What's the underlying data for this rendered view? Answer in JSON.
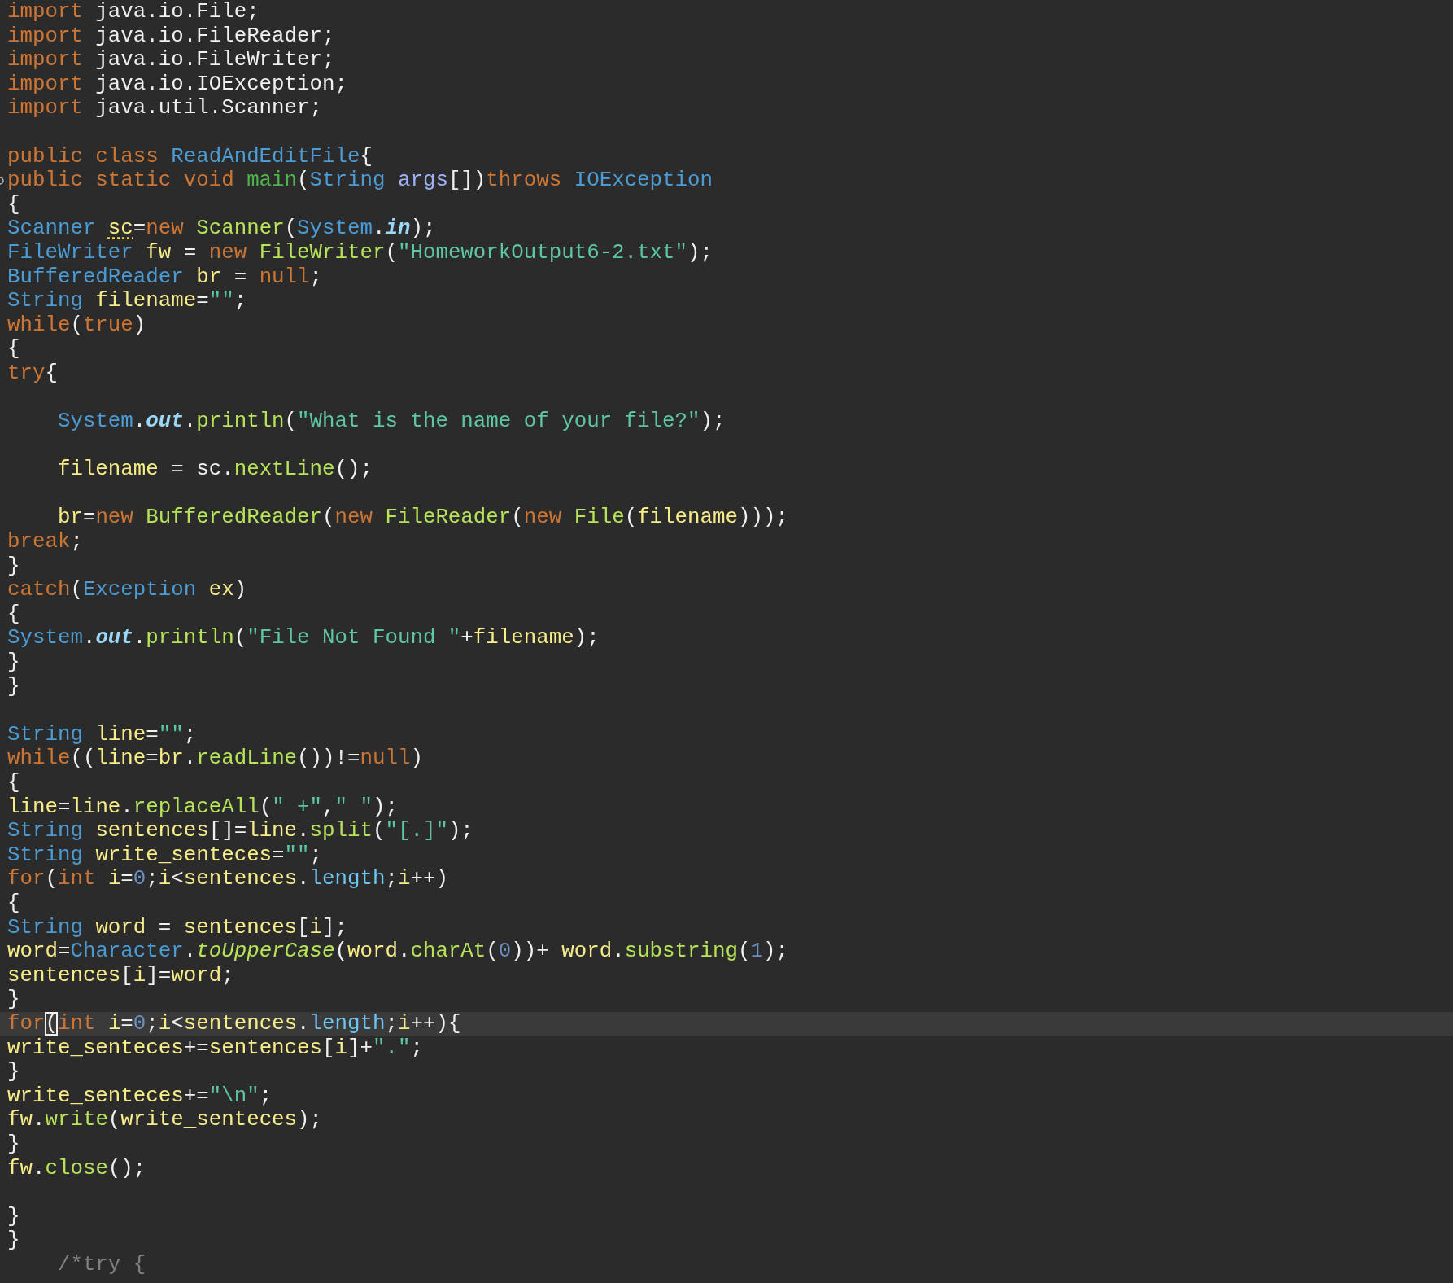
{
  "editor": {
    "lines": [
      {
        "current": false,
        "marker": false,
        "tokens": [
          {
            "kind": "keyword",
            "text": "import"
          },
          {
            "kind": "plain",
            "text": " java.io.File;"
          }
        ]
      },
      {
        "current": false,
        "marker": false,
        "tokens": [
          {
            "kind": "keyword",
            "text": "import"
          },
          {
            "kind": "plain",
            "text": " java.io.FileReader;"
          }
        ]
      },
      {
        "current": false,
        "marker": false,
        "tokens": [
          {
            "kind": "keyword",
            "text": "import"
          },
          {
            "kind": "plain",
            "text": " java.io.FileWriter;"
          }
        ]
      },
      {
        "current": false,
        "marker": false,
        "tokens": [
          {
            "kind": "keyword",
            "text": "import"
          },
          {
            "kind": "plain",
            "text": " java.io.IOException;"
          }
        ]
      },
      {
        "current": false,
        "marker": false,
        "tokens": [
          {
            "kind": "keyword",
            "text": "import"
          },
          {
            "kind": "plain",
            "text": " java.util.Scanner;"
          }
        ]
      },
      {
        "current": false,
        "marker": false
      },
      {
        "current": false,
        "marker": false,
        "tokens": [
          {
            "kind": "keyword",
            "text": "public class "
          },
          {
            "kind": "type",
            "text": "ReadAndEditFile"
          },
          {
            "kind": "plain",
            "text": "{"
          }
        ]
      },
      {
        "current": false,
        "marker": true,
        "tokens": [
          {
            "kind": "keyword",
            "text": "public static void "
          },
          {
            "kind": "decl",
            "text": "main"
          },
          {
            "kind": "plain",
            "text": "("
          },
          {
            "kind": "type",
            "text": "String "
          },
          {
            "kind": "param",
            "text": "args"
          },
          {
            "kind": "plain",
            "text": "[])"
          },
          {
            "kind": "keyword",
            "text": "throws "
          },
          {
            "kind": "type",
            "text": "IOException"
          }
        ]
      },
      {
        "current": false,
        "marker": false,
        "tokens": [
          {
            "kind": "plain",
            "text": "{"
          }
        ]
      },
      {
        "current": false,
        "marker": false,
        "tokens": [
          {
            "kind": "type",
            "text": "Scanner "
          },
          {
            "kind": "warning",
            "text": "sc"
          },
          {
            "kind": "plain",
            "text": "="
          },
          {
            "kind": "keyword",
            "text": "new "
          },
          {
            "kind": "method",
            "text": "Scanner"
          },
          {
            "kind": "plain",
            "text": "("
          },
          {
            "kind": "type",
            "text": "System"
          },
          {
            "kind": "plain",
            "text": "."
          },
          {
            "kind": "field",
            "text": "in"
          },
          {
            "kind": "plain",
            "text": ");"
          }
        ]
      },
      {
        "current": false,
        "marker": false,
        "tokens": [
          {
            "kind": "type",
            "text": "FileWriter "
          },
          {
            "kind": "variable",
            "text": "fw"
          },
          {
            "kind": "plain",
            "text": " = "
          },
          {
            "kind": "keyword",
            "text": "new "
          },
          {
            "kind": "method",
            "text": "FileWriter"
          },
          {
            "kind": "plain",
            "text": "("
          },
          {
            "kind": "string",
            "text": "\"HomeworkOutput6-2.txt\""
          },
          {
            "kind": "plain",
            "text": ");"
          }
        ]
      },
      {
        "current": false,
        "marker": false,
        "tokens": [
          {
            "kind": "type",
            "text": "BufferedReader "
          },
          {
            "kind": "variable",
            "text": "br"
          },
          {
            "kind": "plain",
            "text": " = "
          },
          {
            "kind": "keyword",
            "text": "null"
          },
          {
            "kind": "plain",
            "text": ";"
          }
        ]
      },
      {
        "current": false,
        "marker": false,
        "tokens": [
          {
            "kind": "type",
            "text": "String "
          },
          {
            "kind": "variable",
            "text": "filename"
          },
          {
            "kind": "plain",
            "text": "="
          },
          {
            "kind": "string",
            "text": "\"\""
          },
          {
            "kind": "plain",
            "text": ";"
          }
        ]
      },
      {
        "current": false,
        "marker": false,
        "tokens": [
          {
            "kind": "keyword",
            "text": "while"
          },
          {
            "kind": "plain",
            "text": "("
          },
          {
            "kind": "keyword",
            "text": "true"
          },
          {
            "kind": "plain",
            "text": ")"
          }
        ]
      },
      {
        "current": false,
        "marker": false,
        "tokens": [
          {
            "kind": "plain",
            "text": "{"
          }
        ]
      },
      {
        "current": false,
        "marker": false,
        "tokens": [
          {
            "kind": "keyword",
            "text": "try"
          },
          {
            "kind": "plain",
            "text": "{"
          }
        ]
      },
      {
        "current": false,
        "marker": false
      },
      {
        "current": false,
        "marker": false,
        "tokens": [
          {
            "kind": "type",
            "text": "    System"
          },
          {
            "kind": "plain",
            "text": "."
          },
          {
            "kind": "field",
            "text": "out"
          },
          {
            "kind": "plain",
            "text": "."
          },
          {
            "kind": "method",
            "text": "println"
          },
          {
            "kind": "plain",
            "text": "("
          },
          {
            "kind": "string",
            "text": "\"What is the name of your file?\""
          },
          {
            "kind": "plain",
            "text": ");"
          }
        ]
      },
      {
        "current": false,
        "marker": false
      },
      {
        "current": false,
        "marker": false,
        "tokens": [
          {
            "kind": "variable",
            "text": "    filename"
          },
          {
            "kind": "plain",
            "text": " = sc."
          },
          {
            "kind": "method",
            "text": "nextLine"
          },
          {
            "kind": "plain",
            "text": "();"
          }
        ]
      },
      {
        "current": false,
        "marker": false
      },
      {
        "current": false,
        "marker": false,
        "tokens": [
          {
            "kind": "variable",
            "text": "    br"
          },
          {
            "kind": "plain",
            "text": "="
          },
          {
            "kind": "keyword",
            "text": "new "
          },
          {
            "kind": "method",
            "text": "BufferedReader"
          },
          {
            "kind": "plain",
            "text": "("
          },
          {
            "kind": "keyword",
            "text": "new "
          },
          {
            "kind": "method",
            "text": "FileReader"
          },
          {
            "kind": "plain",
            "text": "("
          },
          {
            "kind": "keyword",
            "text": "new "
          },
          {
            "kind": "method",
            "text": "File"
          },
          {
            "kind": "plain",
            "text": "("
          },
          {
            "kind": "variable",
            "text": "filename"
          },
          {
            "kind": "plain",
            "text": ")));"
          }
        ]
      },
      {
        "current": false,
        "marker": false,
        "tokens": [
          {
            "kind": "keyword",
            "text": "break"
          },
          {
            "kind": "plain",
            "text": ";"
          }
        ]
      },
      {
        "current": false,
        "marker": false,
        "tokens": [
          {
            "kind": "plain",
            "text": "}"
          }
        ]
      },
      {
        "current": false,
        "marker": false,
        "tokens": [
          {
            "kind": "keyword",
            "text": "catch"
          },
          {
            "kind": "plain",
            "text": "("
          },
          {
            "kind": "type",
            "text": "Exception "
          },
          {
            "kind": "variable",
            "text": "ex"
          },
          {
            "kind": "plain",
            "text": ")"
          }
        ]
      },
      {
        "current": false,
        "marker": false,
        "tokens": [
          {
            "kind": "plain",
            "text": "{"
          }
        ]
      },
      {
        "current": false,
        "marker": false,
        "tokens": [
          {
            "kind": "type",
            "text": "System"
          },
          {
            "kind": "plain",
            "text": "."
          },
          {
            "kind": "field",
            "text": "out"
          },
          {
            "kind": "plain",
            "text": "."
          },
          {
            "kind": "method",
            "text": "println"
          },
          {
            "kind": "plain",
            "text": "("
          },
          {
            "kind": "string",
            "text": "\"File Not Found \""
          },
          {
            "kind": "plain",
            "text": "+"
          },
          {
            "kind": "variable",
            "text": "filename"
          },
          {
            "kind": "plain",
            "text": ");"
          }
        ]
      },
      {
        "current": false,
        "marker": false,
        "tokens": [
          {
            "kind": "plain",
            "text": "}"
          }
        ]
      },
      {
        "current": false,
        "marker": false,
        "tokens": [
          {
            "kind": "plain",
            "text": "}"
          }
        ]
      },
      {
        "current": false,
        "marker": false
      },
      {
        "current": false,
        "marker": false,
        "tokens": [
          {
            "kind": "type",
            "text": "String "
          },
          {
            "kind": "variable",
            "text": "line"
          },
          {
            "kind": "plain",
            "text": "="
          },
          {
            "kind": "string",
            "text": "\"\""
          },
          {
            "kind": "plain",
            "text": ";"
          }
        ]
      },
      {
        "current": false,
        "marker": false,
        "tokens": [
          {
            "kind": "keyword",
            "text": "while"
          },
          {
            "kind": "plain",
            "text": "(("
          },
          {
            "kind": "variable",
            "text": "line"
          },
          {
            "kind": "plain",
            "text": "="
          },
          {
            "kind": "variable",
            "text": "br"
          },
          {
            "kind": "plain",
            "text": "."
          },
          {
            "kind": "method",
            "text": "readLine"
          },
          {
            "kind": "plain",
            "text": "())!="
          },
          {
            "kind": "keyword",
            "text": "null"
          },
          {
            "kind": "plain",
            "text": ")"
          }
        ]
      },
      {
        "current": false,
        "marker": false,
        "tokens": [
          {
            "kind": "plain",
            "text": "{"
          }
        ]
      },
      {
        "current": false,
        "marker": false,
        "tokens": [
          {
            "kind": "variable",
            "text": "line"
          },
          {
            "kind": "plain",
            "text": "="
          },
          {
            "kind": "variable",
            "text": "line"
          },
          {
            "kind": "plain",
            "text": "."
          },
          {
            "kind": "method",
            "text": "replaceAll"
          },
          {
            "kind": "plain",
            "text": "("
          },
          {
            "kind": "string",
            "text": "\" +\""
          },
          {
            "kind": "plain",
            "text": ","
          },
          {
            "kind": "string",
            "text": "\" \""
          },
          {
            "kind": "plain",
            "text": ");"
          }
        ]
      },
      {
        "current": false,
        "marker": false,
        "tokens": [
          {
            "kind": "type",
            "text": "String "
          },
          {
            "kind": "variable",
            "text": "sentences"
          },
          {
            "kind": "plain",
            "text": "[]="
          },
          {
            "kind": "variable",
            "text": "line"
          },
          {
            "kind": "plain",
            "text": "."
          },
          {
            "kind": "method",
            "text": "split"
          },
          {
            "kind": "plain",
            "text": "("
          },
          {
            "kind": "string",
            "text": "\"[.]\""
          },
          {
            "kind": "plain",
            "text": ");"
          }
        ]
      },
      {
        "current": false,
        "marker": false,
        "tokens": [
          {
            "kind": "type",
            "text": "String "
          },
          {
            "kind": "variable",
            "text": "write_senteces"
          },
          {
            "kind": "plain",
            "text": "="
          },
          {
            "kind": "string",
            "text": "\"\""
          },
          {
            "kind": "plain",
            "text": ";"
          }
        ]
      },
      {
        "current": false,
        "marker": false,
        "tokens": [
          {
            "kind": "keyword",
            "text": "for"
          },
          {
            "kind": "plain",
            "text": "("
          },
          {
            "kind": "keyword",
            "text": "int "
          },
          {
            "kind": "variable",
            "text": "i"
          },
          {
            "kind": "plain",
            "text": "="
          },
          {
            "kind": "number",
            "text": "0"
          },
          {
            "kind": "plain",
            "text": ";"
          },
          {
            "kind": "variable",
            "text": "i"
          },
          {
            "kind": "plain",
            "text": "<"
          },
          {
            "kind": "variable",
            "text": "sentences"
          },
          {
            "kind": "plain",
            "text": "."
          },
          {
            "kind": "property",
            "text": "length"
          },
          {
            "kind": "plain",
            "text": ";"
          },
          {
            "kind": "variable",
            "text": "i"
          },
          {
            "kind": "plain",
            "text": "++)"
          }
        ]
      },
      {
        "current": false,
        "marker": false,
        "tokens": [
          {
            "kind": "plain",
            "text": "{"
          }
        ]
      },
      {
        "current": false,
        "marker": false,
        "tokens": [
          {
            "kind": "type",
            "text": "String "
          },
          {
            "kind": "variable",
            "text": "word"
          },
          {
            "kind": "plain",
            "text": " = "
          },
          {
            "kind": "variable",
            "text": "sentences"
          },
          {
            "kind": "plain",
            "text": "["
          },
          {
            "kind": "variable",
            "text": "i"
          },
          {
            "kind": "plain",
            "text": "];"
          }
        ]
      },
      {
        "current": false,
        "marker": false,
        "tokens": [
          {
            "kind": "variable",
            "text": "word"
          },
          {
            "kind": "plain",
            "text": "="
          },
          {
            "kind": "type",
            "text": "Character"
          },
          {
            "kind": "plain",
            "text": "."
          },
          {
            "kind": "static",
            "text": "toUpperCase"
          },
          {
            "kind": "plain",
            "text": "("
          },
          {
            "kind": "variable",
            "text": "word"
          },
          {
            "kind": "plain",
            "text": "."
          },
          {
            "kind": "method",
            "text": "charAt"
          },
          {
            "kind": "plain",
            "text": "("
          },
          {
            "kind": "number",
            "text": "0"
          },
          {
            "kind": "plain",
            "text": "))+ "
          },
          {
            "kind": "variable",
            "text": "word"
          },
          {
            "kind": "plain",
            "text": "."
          },
          {
            "kind": "method",
            "text": "substring"
          },
          {
            "kind": "plain",
            "text": "("
          },
          {
            "kind": "number",
            "text": "1"
          },
          {
            "kind": "plain",
            "text": ");"
          }
        ]
      },
      {
        "current": false,
        "marker": false,
        "tokens": [
          {
            "kind": "variable",
            "text": "sentences"
          },
          {
            "kind": "plain",
            "text": "["
          },
          {
            "kind": "variable",
            "text": "i"
          },
          {
            "kind": "plain",
            "text": "]="
          },
          {
            "kind": "variable",
            "text": "word"
          },
          {
            "kind": "plain",
            "text": ";"
          }
        ]
      },
      {
        "current": false,
        "marker": false,
        "tokens": [
          {
            "kind": "plain",
            "text": "}"
          }
        ]
      },
      {
        "current": true,
        "marker": false,
        "tokens": [
          {
            "kind": "keyword",
            "text": "for"
          },
          {
            "kind": "cursor",
            "text": "("
          },
          {
            "kind": "keyword",
            "text": "int "
          },
          {
            "kind": "variable",
            "text": "i"
          },
          {
            "kind": "plain",
            "text": "="
          },
          {
            "kind": "number",
            "text": "0"
          },
          {
            "kind": "plain",
            "text": ";"
          },
          {
            "kind": "variable",
            "text": "i"
          },
          {
            "kind": "plain",
            "text": "<"
          },
          {
            "kind": "variable",
            "text": "sentences"
          },
          {
            "kind": "plain",
            "text": "."
          },
          {
            "kind": "property",
            "text": "length"
          },
          {
            "kind": "plain",
            "text": ";"
          },
          {
            "kind": "variable",
            "text": "i"
          },
          {
            "kind": "plain",
            "text": "++){"
          }
        ]
      },
      {
        "current": false,
        "marker": false,
        "tokens": [
          {
            "kind": "variable",
            "text": "write_senteces"
          },
          {
            "kind": "plain",
            "text": "+="
          },
          {
            "kind": "variable",
            "text": "sentences"
          },
          {
            "kind": "plain",
            "text": "["
          },
          {
            "kind": "variable",
            "text": "i"
          },
          {
            "kind": "plain",
            "text": "]+"
          },
          {
            "kind": "string",
            "text": "\".\""
          },
          {
            "kind": "plain",
            "text": ";"
          }
        ]
      },
      {
        "current": false,
        "marker": false,
        "tokens": [
          {
            "kind": "plain",
            "text": "}"
          }
        ]
      },
      {
        "current": false,
        "marker": false,
        "tokens": [
          {
            "kind": "variable",
            "text": "write_senteces"
          },
          {
            "kind": "plain",
            "text": "+="
          },
          {
            "kind": "string",
            "text": "\"\\n\""
          },
          {
            "kind": "plain",
            "text": ";"
          }
        ]
      },
      {
        "current": false,
        "marker": false,
        "tokens": [
          {
            "kind": "variable",
            "text": "fw"
          },
          {
            "kind": "plain",
            "text": "."
          },
          {
            "kind": "method",
            "text": "write"
          },
          {
            "kind": "plain",
            "text": "("
          },
          {
            "kind": "variable",
            "text": "write_senteces"
          },
          {
            "kind": "plain",
            "text": ");"
          }
        ]
      },
      {
        "current": false,
        "marker": false,
        "tokens": [
          {
            "kind": "plain",
            "text": "}"
          }
        ]
      },
      {
        "current": false,
        "marker": false,
        "tokens": [
          {
            "kind": "variable",
            "text": "fw"
          },
          {
            "kind": "plain",
            "text": "."
          },
          {
            "kind": "method",
            "text": "close"
          },
          {
            "kind": "plain",
            "text": "();"
          }
        ]
      },
      {
        "current": false,
        "marker": false
      },
      {
        "current": false,
        "marker": false,
        "tokens": [
          {
            "kind": "plain",
            "text": "}"
          }
        ]
      },
      {
        "current": false,
        "marker": false,
        "tokens": [
          {
            "kind": "plain",
            "text": "}"
          }
        ]
      },
      {
        "current": false,
        "marker": false,
        "tokens": [
          {
            "kind": "comment",
            "text": "    /*try {"
          }
        ]
      }
    ]
  }
}
